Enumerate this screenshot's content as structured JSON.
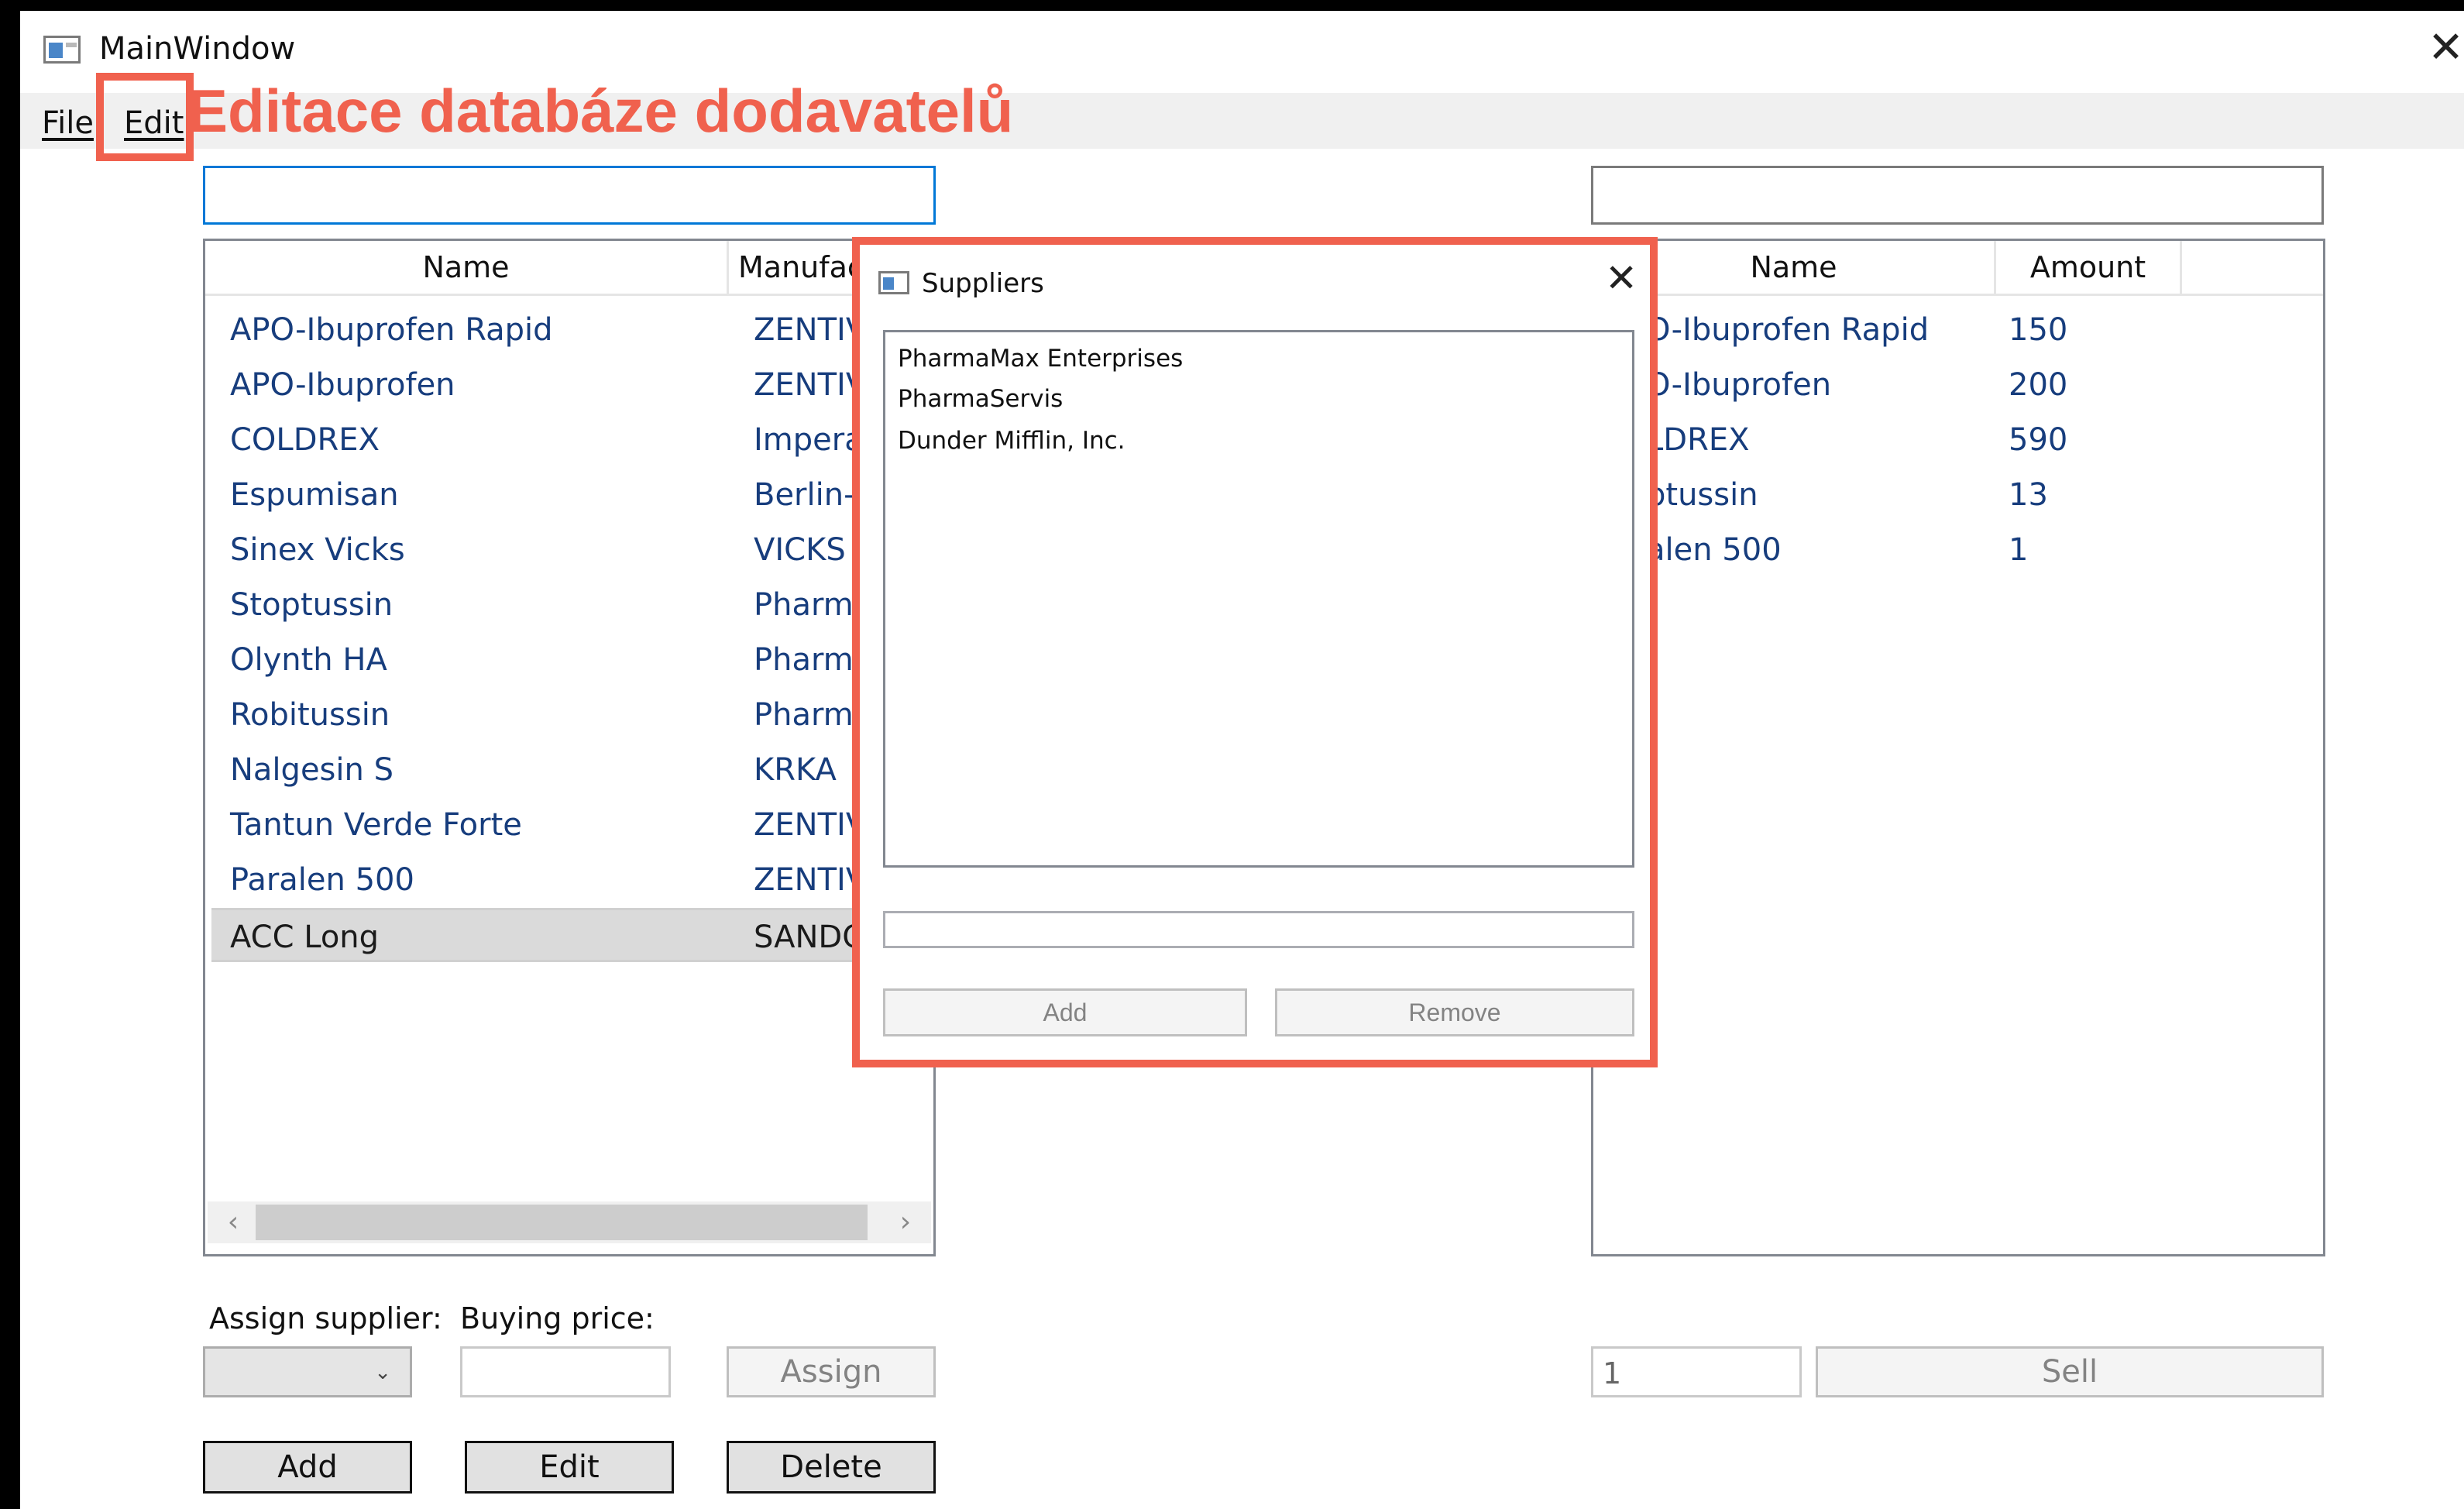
{
  "window": {
    "title": "MainWindow"
  },
  "menu": {
    "file": "File",
    "edit": "Edit"
  },
  "annotation": {
    "text": "Editace databáze dodavatelů",
    "color": "#f0614e"
  },
  "products": {
    "columns": [
      "Name",
      "Manufac"
    ],
    "rows": [
      {
        "name": "APO-Ibuprofen Rapid",
        "manufacturer": "ZENTIV"
      },
      {
        "name": "APO-Ibuprofen",
        "manufacturer": "ZENTIV"
      },
      {
        "name": "COLDREX",
        "manufacturer": "Impera"
      },
      {
        "name": "Espumisan",
        "manufacturer": "Berlin-C"
      },
      {
        "name": "Sinex Vicks",
        "manufacturer": "VICKS"
      },
      {
        "name": "Stoptussin",
        "manufacturer": "Pharma"
      },
      {
        "name": "Olynth HA",
        "manufacturer": "Pharma"
      },
      {
        "name": "Robitussin",
        "manufacturer": "Pharma"
      },
      {
        "name": "Nalgesin S",
        "manufacturer": "KRKA"
      },
      {
        "name": "Tantun Verde Forte",
        "manufacturer": "ZENTIV"
      },
      {
        "name": "Paralen 500",
        "manufacturer": "ZENTIV"
      },
      {
        "name": "ACC Long",
        "manufacturer": "SANDC"
      }
    ],
    "selected_index": 11
  },
  "stock": {
    "columns": [
      "Name",
      "Amount"
    ],
    "rows": [
      {
        "name": "O-Ibuprofen Rapid",
        "amount": "150"
      },
      {
        "name": "O-Ibuprofen",
        "amount": "200"
      },
      {
        "name": "LDREX",
        "amount": "590"
      },
      {
        "name": "ptussin",
        "amount": "13"
      },
      {
        "name": "alen 500",
        "amount": "1"
      }
    ]
  },
  "assign": {
    "supplier_label": "Assign supplier:",
    "price_label": "Buying price:",
    "assign_button": "Assign"
  },
  "actions": {
    "add": "Add",
    "edit": "Edit",
    "delete": "Delete"
  },
  "sell": {
    "quantity": "1",
    "sell_button": "Sell"
  },
  "dialog": {
    "title": "Suppliers",
    "suppliers": [
      "PharmaMax Enterprises",
      "PharmaServis",
      "Dunder Mifflin, Inc."
    ],
    "add_button": "Add",
    "remove_button": "Remove"
  }
}
